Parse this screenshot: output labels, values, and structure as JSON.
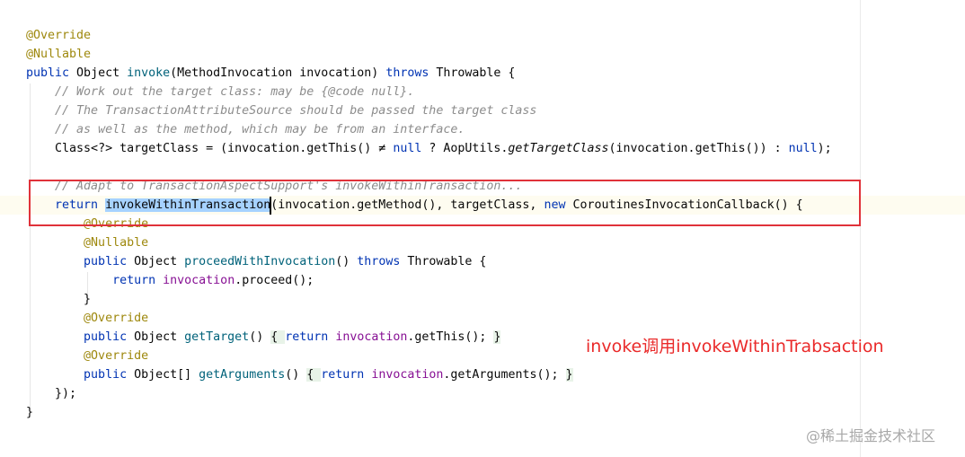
{
  "colors": {
    "keyword": "#0033b3",
    "annotation": "#9e880d",
    "method": "#00627a",
    "comment": "#8c8c8c",
    "field": "#871094",
    "highlight_box": "#e0323a",
    "annotation_note": "#ea2a2a"
  },
  "code": {
    "lines": [
      {
        "indent": 0,
        "tokens": [
          {
            "t": "@Override",
            "k": "ann"
          }
        ]
      },
      {
        "indent": 0,
        "tokens": [
          {
            "t": "@Nullable",
            "k": "ann"
          }
        ]
      },
      {
        "indent": 0,
        "tokens": [
          {
            "t": "public",
            "k": "kw"
          },
          {
            "t": " Object "
          },
          {
            "t": "invoke",
            "k": "fn"
          },
          {
            "t": "(MethodInvocation invocation) "
          },
          {
            "t": "throws",
            "k": "kw"
          },
          {
            "t": " Throwable {"
          }
        ]
      },
      {
        "indent": 1,
        "tokens": [
          {
            "t": "// Work out the target class: may be {@code null}.",
            "k": "cm"
          }
        ]
      },
      {
        "indent": 1,
        "tokens": [
          {
            "t": "// The TransactionAttributeSource should be passed the target class",
            "k": "cm"
          }
        ]
      },
      {
        "indent": 1,
        "tokens": [
          {
            "t": "// as well as the method, which may be from an interface.",
            "k": "cm"
          }
        ]
      },
      {
        "indent": 1,
        "tokens": [
          {
            "t": "Class<?> targetClass = (invocation.getThis() "
          },
          {
            "t": "≠",
            "k": ""
          },
          {
            "t": " "
          },
          {
            "t": "null",
            "k": "kw"
          },
          {
            "t": " ? AopUtils."
          },
          {
            "t": "getTargetClass",
            "k": "it"
          },
          {
            "t": "(invocation.getThis()) : "
          },
          {
            "t": "null",
            "k": "kw"
          },
          {
            "t": ");"
          }
        ]
      },
      {
        "indent": 0,
        "tokens": []
      },
      {
        "indent": 1,
        "tokens": [
          {
            "t": "// Adapt to TransactionAspectSupport's invokeWithinTransaction...",
            "k": "cm"
          }
        ]
      },
      {
        "indent": 1,
        "current": true,
        "tokens": [
          {
            "t": "return",
            "k": "kw"
          },
          {
            "t": " "
          },
          {
            "t": "invokeWithinTransaction",
            "k": "sel"
          },
          {
            "t": "(invocation.getMethod(), targetClass, "
          },
          {
            "t": "new",
            "k": "kw"
          },
          {
            "t": " CoroutinesInvocationCallback() {"
          }
        ]
      },
      {
        "indent": 2,
        "tokens": [
          {
            "t": "@Override",
            "k": "ann"
          }
        ]
      },
      {
        "indent": 2,
        "tokens": [
          {
            "t": "@Nullable",
            "k": "ann"
          }
        ]
      },
      {
        "indent": 2,
        "tokens": [
          {
            "t": "public",
            "k": "kw"
          },
          {
            "t": " Object "
          },
          {
            "t": "proceedWithInvocation",
            "k": "fn"
          },
          {
            "t": "() "
          },
          {
            "t": "throws",
            "k": "kw"
          },
          {
            "t": " Throwable {"
          }
        ]
      },
      {
        "indent": 3,
        "tokens": [
          {
            "t": "return",
            "k": "kw"
          },
          {
            "t": " "
          },
          {
            "t": "invocation",
            "k": "fld"
          },
          {
            "t": ".proceed();"
          }
        ]
      },
      {
        "indent": 2,
        "tokens": [
          {
            "t": "}"
          }
        ]
      },
      {
        "indent": 2,
        "tokens": [
          {
            "t": "@Override",
            "k": "ann"
          }
        ]
      },
      {
        "indent": 2,
        "tokens": [
          {
            "t": "public",
            "k": "kw"
          },
          {
            "t": " Object "
          },
          {
            "t": "getTarget",
            "k": "fn"
          },
          {
            "t": "() "
          },
          {
            "t": "{ ",
            "k": "fold"
          },
          {
            "t": "return",
            "k": "kw"
          },
          {
            "t": " "
          },
          {
            "t": "invocation",
            "k": "fld"
          },
          {
            "t": ".getThis(); "
          },
          {
            "t": "}",
            "k": "fold"
          }
        ]
      },
      {
        "indent": 2,
        "tokens": [
          {
            "t": "@Override",
            "k": "ann"
          }
        ]
      },
      {
        "indent": 2,
        "tokens": [
          {
            "t": "public",
            "k": "kw"
          },
          {
            "t": " Object[] "
          },
          {
            "t": "getArguments",
            "k": "fn"
          },
          {
            "t": "() "
          },
          {
            "t": "{ ",
            "k": "fold"
          },
          {
            "t": "return",
            "k": "kw"
          },
          {
            "t": " "
          },
          {
            "t": "invocation",
            "k": "fld"
          },
          {
            "t": ".getArguments(); "
          },
          {
            "t": "}",
            "k": "fold"
          }
        ]
      },
      {
        "indent": 1,
        "tokens": [
          {
            "t": "});"
          }
        ]
      },
      {
        "indent": 0,
        "tokens": [
          {
            "t": "}"
          }
        ]
      }
    ]
  },
  "annotation_note": "invoke调用invokeWithinTrabsaction",
  "watermark": "@稀土掘金技术社区"
}
